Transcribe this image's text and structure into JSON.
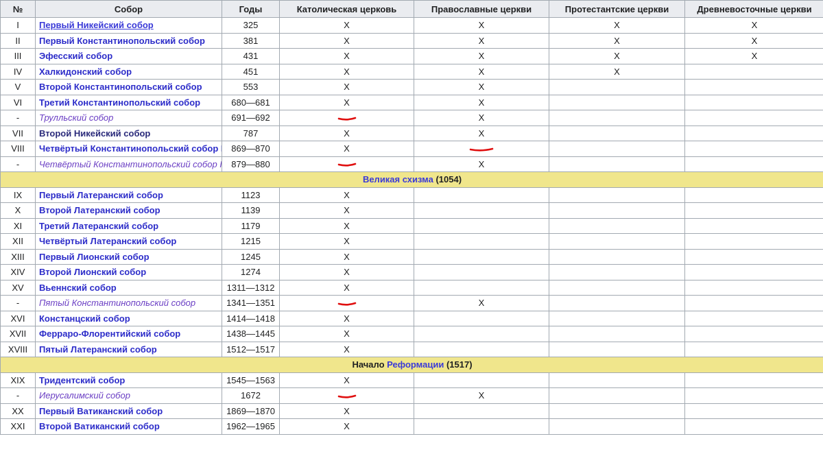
{
  "headers": [
    "№",
    "Собор",
    "Годы",
    "Католическая церковь",
    "Православные церкви",
    "Протестантские церкви",
    "Древневосточные церкви"
  ],
  "mark": "X",
  "rows": [
    {
      "type": "council",
      "num": "I",
      "name": "Первый Никейский собор",
      "years": "325",
      "cat": "X",
      "orth": "X",
      "prot": "X",
      "orient": "X",
      "style": "first"
    },
    {
      "type": "council",
      "num": "II",
      "name": "Первый Константинопольский собор",
      "years": "381",
      "cat": "X",
      "orth": "X",
      "prot": "X",
      "orient": "X",
      "style": "blue"
    },
    {
      "type": "council",
      "num": "III",
      "name": "Эфесский собор",
      "years": "431",
      "cat": "X",
      "orth": "X",
      "prot": "X",
      "orient": "X",
      "style": "blue"
    },
    {
      "type": "council",
      "num": "IV",
      "name": "Халкидонский собор",
      "years": "451",
      "cat": "X",
      "orth": "X",
      "prot": "X",
      "orient": "",
      "style": "blue"
    },
    {
      "type": "council",
      "num": "V",
      "name": "Второй Константинопольский собор",
      "years": "553",
      "cat": "X",
      "orth": "X",
      "prot": "",
      "orient": "",
      "style": "blue"
    },
    {
      "type": "council",
      "num": "VI",
      "name": "Третий Константинопольский собор",
      "years": "680—681",
      "cat": "X",
      "orth": "X",
      "prot": "",
      "orient": "",
      "style": "blue"
    },
    {
      "type": "council",
      "num": "-",
      "name": "Трулльский собор",
      "years": "691—692",
      "cat": "",
      "orth": "X",
      "prot": "",
      "orient": "",
      "style": "italic",
      "redCat": true
    },
    {
      "type": "council",
      "num": "VII",
      "name": "Второй Никейский собор",
      "years": "787",
      "cat": "X",
      "orth": "X",
      "prot": "",
      "orient": "",
      "style": "dark"
    },
    {
      "type": "council",
      "num": "VIII",
      "name": "Четвёртый Константинопольский собор I",
      "years": "869—870",
      "cat": "X",
      "orth": "",
      "prot": "",
      "orient": "",
      "style": "blue",
      "redOrth": true
    },
    {
      "type": "council",
      "num": "-",
      "name": "Четвёртый Константинопольский собор II",
      "years": "879—880",
      "cat": "",
      "orth": "X",
      "prot": "",
      "orient": "",
      "style": "italic",
      "redCat": true
    },
    {
      "type": "section",
      "prefix": "",
      "link": "Великая схизма",
      "suffix": " (1054)"
    },
    {
      "type": "council",
      "num": "IX",
      "name": "Первый Латеранский собор",
      "years": "1123",
      "cat": "X",
      "orth": "",
      "prot": "",
      "orient": "",
      "style": "blue"
    },
    {
      "type": "council",
      "num": "X",
      "name": "Второй Латеранский собор",
      "years": "1139",
      "cat": "X",
      "orth": "",
      "prot": "",
      "orient": "",
      "style": "blue"
    },
    {
      "type": "council",
      "num": "XI",
      "name": "Третий Латеранский собор",
      "years": "1179",
      "cat": "X",
      "orth": "",
      "prot": "",
      "orient": "",
      "style": "blue"
    },
    {
      "type": "council",
      "num": "XII",
      "name": "Четвёртый Латеранский собор",
      "years": "1215",
      "cat": "X",
      "orth": "",
      "prot": "",
      "orient": "",
      "style": "blue"
    },
    {
      "type": "council",
      "num": "XIII",
      "name": "Первый Лионский собор",
      "years": "1245",
      "cat": "X",
      "orth": "",
      "prot": "",
      "orient": "",
      "style": "blue"
    },
    {
      "type": "council",
      "num": "XIV",
      "name": "Второй Лионский собор",
      "years": "1274",
      "cat": "X",
      "orth": "",
      "prot": "",
      "orient": "",
      "style": "blue"
    },
    {
      "type": "council",
      "num": "XV",
      "name": "Вьеннский собор",
      "years": "1311—1312",
      "cat": "X",
      "orth": "",
      "prot": "",
      "orient": "",
      "style": "blue"
    },
    {
      "type": "council",
      "num": "-",
      "name": "Пятый Константинопольский собор",
      "years": "1341—1351",
      "cat": "",
      "orth": "X",
      "prot": "",
      "orient": "",
      "style": "italic",
      "redCat": true
    },
    {
      "type": "council",
      "num": "XVI",
      "name": "Констанцский собор",
      "years": "1414—1418",
      "cat": "X",
      "orth": "",
      "prot": "",
      "orient": "",
      "style": "blue"
    },
    {
      "type": "council",
      "num": "XVII",
      "name": "Ферраро-Флорентийский собор",
      "years": "1438—1445",
      "cat": "X",
      "orth": "",
      "prot": "",
      "orient": "",
      "style": "blue"
    },
    {
      "type": "council",
      "num": "XVIII",
      "name": "Пятый Латеранский собор",
      "years": "1512—1517",
      "cat": "X",
      "orth": "",
      "prot": "",
      "orient": "",
      "style": "blue"
    },
    {
      "type": "section",
      "prefix": "Начало ",
      "link": "Реформации",
      "suffix": " (1517)"
    },
    {
      "type": "council",
      "num": "XIX",
      "name": "Тридентский собор",
      "years": "1545—1563",
      "cat": "X",
      "orth": "",
      "prot": "",
      "orient": "",
      "style": "blue"
    },
    {
      "type": "council",
      "num": "-",
      "name": "Иерусалимский собор",
      "years": "1672",
      "cat": "",
      "orth": "X",
      "prot": "",
      "orient": "",
      "style": "italic",
      "redCat": true
    },
    {
      "type": "council",
      "num": "XX",
      "name": "Первый Ватиканский собор",
      "years": "1869—1870",
      "cat": "X",
      "orth": "",
      "prot": "",
      "orient": "",
      "style": "blue"
    },
    {
      "type": "council",
      "num": "XXI",
      "name": "Второй Ватиканский собор",
      "years": "1962—1965",
      "cat": "X",
      "orth": "",
      "prot": "",
      "orient": "",
      "style": "blue"
    }
  ],
  "colors": {
    "header_bg": "#eaecf0",
    "section_bg": "#f0e68c",
    "link": "#3a3ad8",
    "border": "#a2a9b1",
    "red_annotation": "#e01010"
  }
}
